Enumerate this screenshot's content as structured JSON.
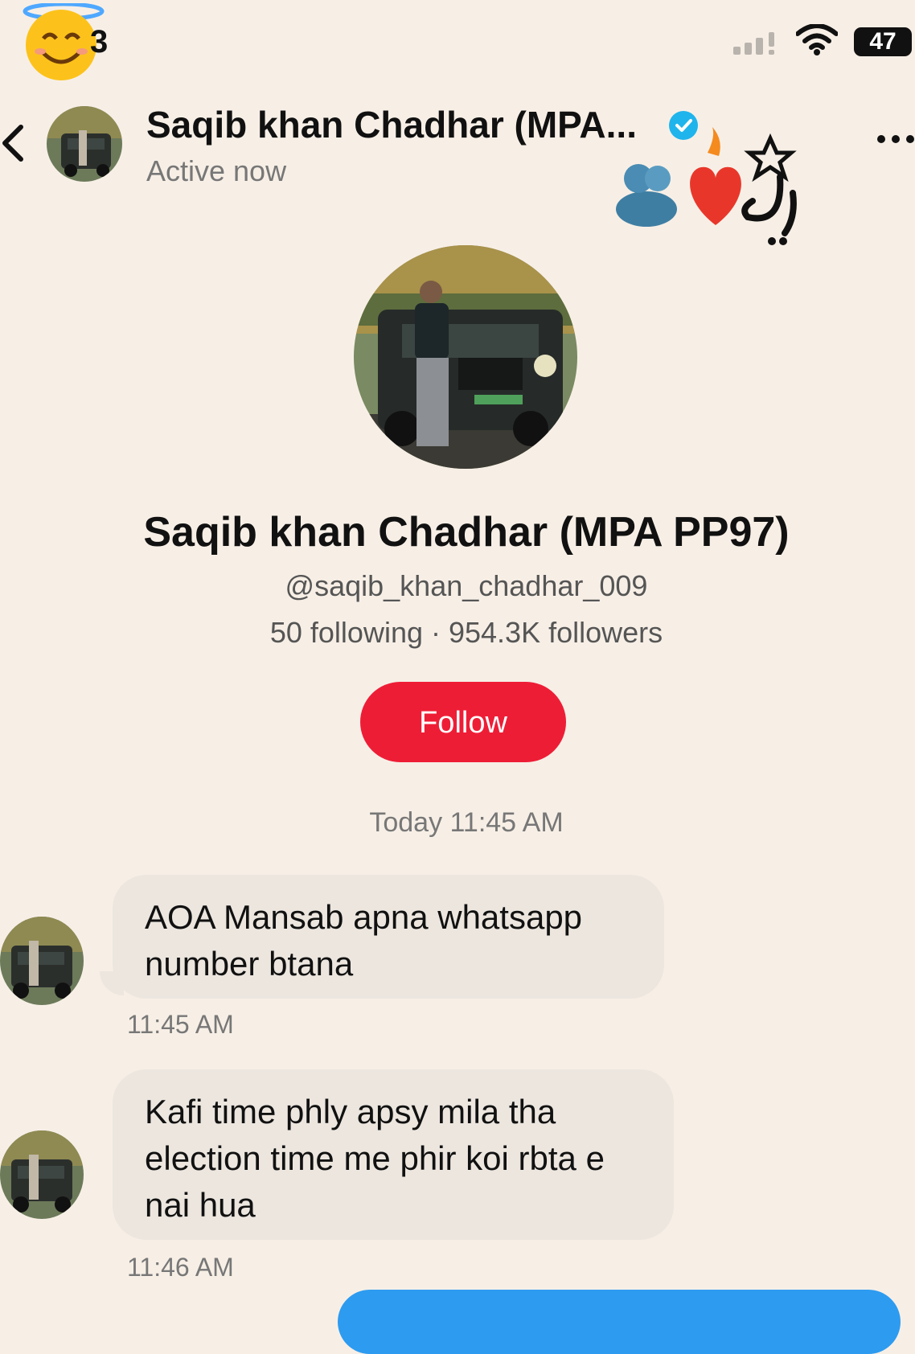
{
  "status_bar": {
    "time": "3",
    "battery": "47"
  },
  "header": {
    "name": "Saqib khan Chadhar (MPA...",
    "status": "Active now"
  },
  "profile": {
    "name": "Saqib khan Chadhar (MPA PP97)",
    "handle": "@saqib_khan_chadhar_009",
    "stats": "50 following · 954.3K followers",
    "follow_label": "Follow"
  },
  "chat": {
    "date_separator": "Today 11:45 AM",
    "messages": [
      {
        "text": "AOA Mansab apna whatsapp number btana",
        "time": "11:45 AM"
      },
      {
        "text": "Kafi time phly apsy mila tha election time me phir koi rbta e nai hua",
        "time": "11:46 AM"
      }
    ]
  },
  "colors": {
    "background": "#f7efe6",
    "follow": "#ee1d36",
    "verified": "#20b4ec",
    "sent_bubble": "#2d9bf0",
    "received_bubble": "#ece6df"
  },
  "icons": [
    "halo-emoji-icon",
    "signal-icon",
    "wifi-icon",
    "battery-icon",
    "back-icon",
    "verified-icon",
    "more-icon",
    "sticker-icon"
  ]
}
